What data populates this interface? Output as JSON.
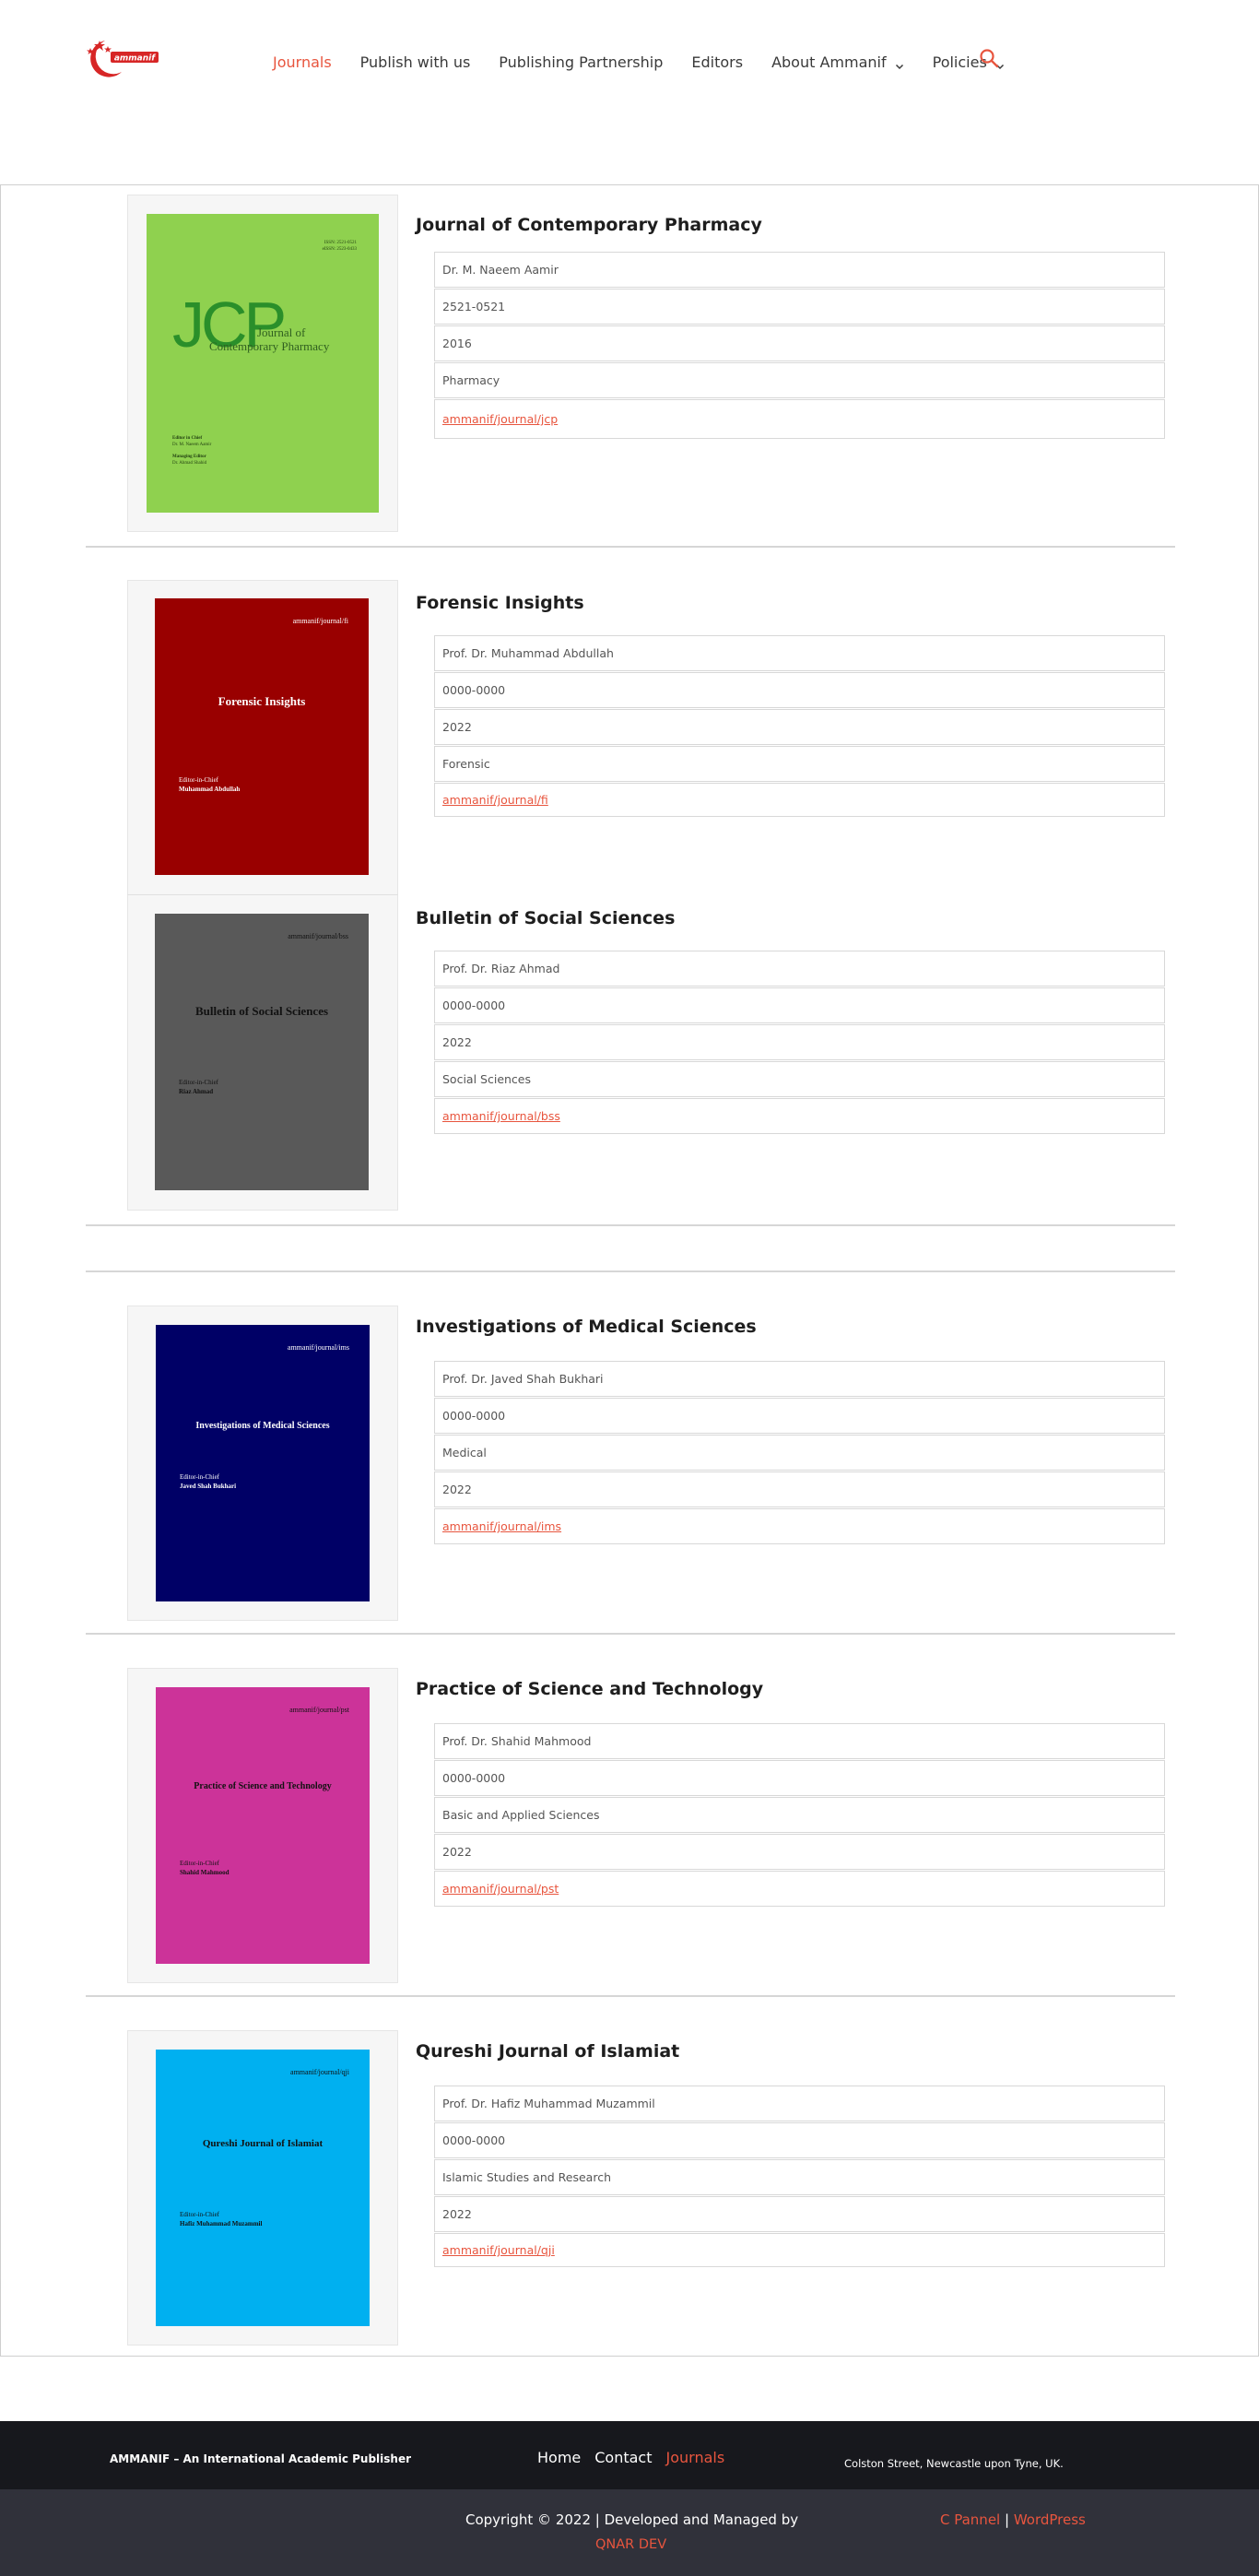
{
  "header": {
    "logo_text": "ammanif",
    "nav": [
      {
        "label": "Journals",
        "active": true
      },
      {
        "label": "Publish with us"
      },
      {
        "label": "Publishing Partnership"
      },
      {
        "label": "Editors"
      },
      {
        "label": "About Ammanif",
        "dropdown": true
      },
      {
        "label": "Policies",
        "dropdown": true
      }
    ],
    "accent_color": "#e8553e"
  },
  "journals": [
    {
      "title": "Journal of Contemporary Pharmacy",
      "fields": [
        "Dr.  M. Naeem Aamir",
        "2521-0521",
        "2016",
        "Pharmacy"
      ],
      "link": "ammanif/journal/jcp",
      "cover": {
        "bg": "#8fd14f",
        "abbr": "JCP",
        "title_line1": "Journal of",
        "title_line2": "Contemporary Pharmacy",
        "issn_top": "ISSN: 2521-0521",
        "issn_bottom": "eISSN: 2523-0433",
        "ed_label": "Editor in Chief",
        "ed_name": "Dr. M. Naeem Aamir",
        "ed2_label": "Managing Editor",
        "ed2_name": "Dr. Ahmad Shahid"
      }
    },
    {
      "title": "Forensic Insights",
      "fields": [
        "Prof. Dr.  Muhammad Abdullah",
        "0000-0000",
        "2022",
        "Forensic"
      ],
      "link": "ammanif/journal/fi",
      "cover": {
        "bg": "#990000",
        "top": "ammanif/journal/fi",
        "title": "Forensic Insights",
        "ed_label": "Editor-in-Chief",
        "ed_name": "Muhammad Abdullah",
        "text_color": "#ffffff"
      }
    },
    {
      "title": "Bulletin of Social Sciences",
      "fields": [
        "Prof. Dr. Riaz Ahmad",
        "0000-0000",
        "2022",
        "Social Sciences"
      ],
      "link": "ammanif/journal/bss",
      "cover": {
        "bg": "#595959",
        "top": "ammanif/journal/bss",
        "title": "Bulletin of Social Sciences",
        "ed_label": "Editor-in-Chief",
        "ed_name": "Riaz Ahmad",
        "text_color": "#111111"
      }
    },
    {
      "title": "Investigations of Medical Sciences",
      "fields": [
        "Prof. Dr.  Javed Shah Bukhari",
        "0000-0000",
        "Medical",
        "2022"
      ],
      "link": "ammanif/journal/ims",
      "cover": {
        "bg": "#000066",
        "top": "ammanif/journal/ims",
        "title": "Investigations of Medical Sciences",
        "ed_label": "Editor-in-Chief",
        "ed_name": "Javed Shah Bukhari",
        "text_color": "#ffffff"
      }
    },
    {
      "title": "Practice of Science and Technology",
      "fields": [
        "Prof. Dr. Shahid Mahmood",
        "0000-0000",
        "Basic and Applied Sciences",
        "2022"
      ],
      "link": "ammanif/journal/pst",
      "cover": {
        "bg": "#cc3399",
        "top": "ammanif/journal/pst",
        "title": "Practice of Science and Technology",
        "ed_label": "Editor-in-Chief",
        "ed_name": "Shahid Mahmood",
        "text_color": "#111111"
      }
    },
    {
      "title": "Qureshi Journal of Islamiat",
      "fields": [
        "Prof. Dr. Hafiz Muhammad Muzammil",
        "0000-0000",
        "Islamic Studies and Research",
        "2022"
      ],
      "link": "ammanif/journal/qji",
      "cover": {
        "bg": "#00b0f0",
        "top": "ammanif/journal/qji",
        "title": "Qureshi Journal of Islamiat",
        "ed_label": "Editor-in-Chief",
        "ed_name": "Hafiz Muhammad Muzammil",
        "text_color": "#111111"
      }
    }
  ],
  "footer": {
    "brand": "AMMANIF – An International Academic Publisher",
    "links": [
      {
        "label": "Home"
      },
      {
        "label": "Contact"
      },
      {
        "label": "Journals",
        "active": true
      }
    ],
    "address": "Colston Street, Newcastle upon Tyne, UK.",
    "copyright": "Copyright © 2022 | Developed and Managed by",
    "developer": "QNAR DEV",
    "right_a": "C Pannel",
    "right_sep": " | ",
    "right_b": "WordPress"
  }
}
